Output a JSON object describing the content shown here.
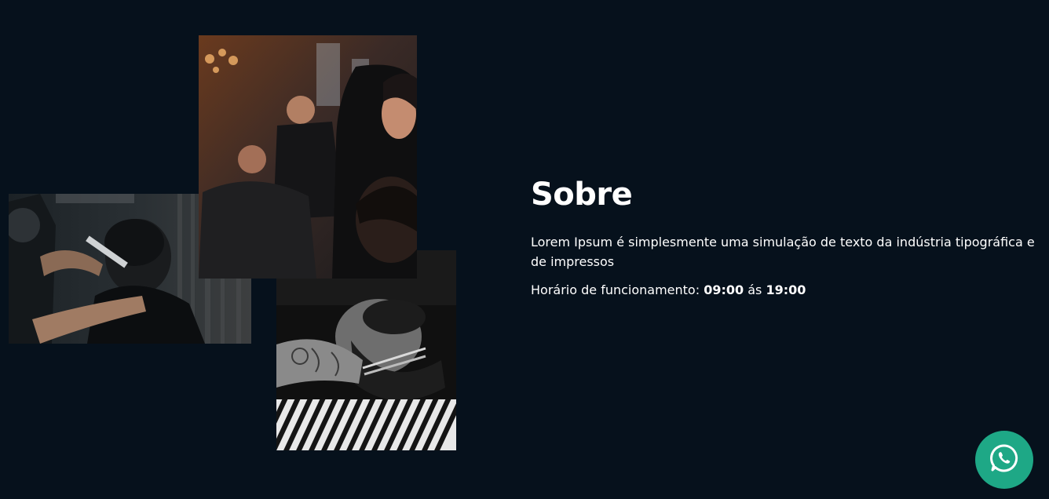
{
  "about": {
    "title": "Sobre",
    "description": "Lorem Ipsum é simplesmente uma simulação de texto da indústria tipográfica e de impressos",
    "hours_label": "Horário de funcionamento:",
    "hours_open": "09:00",
    "hours_separator": "ás",
    "hours_close": "19:00"
  },
  "colors": {
    "background": "#06111c",
    "text": "#ffffff",
    "whatsapp": "#1ea886"
  },
  "icons": {
    "floating_button": "whatsapp-icon"
  }
}
